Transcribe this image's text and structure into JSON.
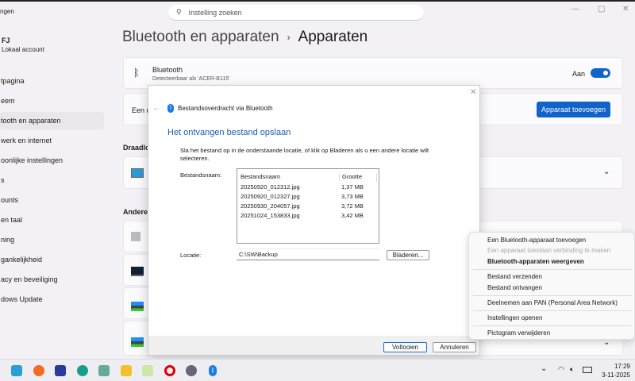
{
  "window": {
    "search_placeholder": "Instelling zoeken",
    "title_fragment": "ngen"
  },
  "user": {
    "name": "FJ",
    "account": "Lokaal account"
  },
  "sidebar": {
    "items": [
      {
        "label": "tpagina"
      },
      {
        "label": "eem"
      },
      {
        "label": "tooth en apparaten"
      },
      {
        "label": "werk en internet"
      },
      {
        "label": "oonlijke instellingen"
      },
      {
        "label": "s"
      },
      {
        "label": "ounts"
      },
      {
        "label": "en taal"
      },
      {
        "label": "ning"
      },
      {
        "label": "gankelijkheid"
      },
      {
        "label": "acy en beveiliging"
      },
      {
        "label": "dows Update"
      }
    ]
  },
  "breadcrumb": {
    "parent": "Bluetooth en apparaten",
    "sep": "›",
    "current": "Apparaten"
  },
  "bluetooth_card": {
    "title": "Bluetooth",
    "subtitle": "Detecteerbaar als 'ACER-B115'",
    "state": "Aan",
    "on": true
  },
  "add_card": {
    "text": "Een n",
    "button": "Apparaat toevoegen"
  },
  "sections": {
    "wireless": "Draadlo",
    "other": "Andere"
  },
  "dialog": {
    "header": "Bestandsoverdracht via Bluetooth",
    "title": "Het ontvangen bestand opslaan",
    "instruction": "Sla het bestand op in de onderstaande locatie, of klik op Bladeren als u een andere locatie wilt selecteren.",
    "filename_label": "Bestandsnaam:",
    "columns": [
      "Bestandsnaam",
      "Grootte"
    ],
    "files": [
      {
        "name": "20250920_012312.jpg",
        "size": "1,37 MB"
      },
      {
        "name": "20250920_012327.jpg",
        "size": "3,73 MB"
      },
      {
        "name": "20250930_204057.jpg",
        "size": "3,72 MB"
      },
      {
        "name": "20251024_153833.jpg",
        "size": "3,42 MB"
      }
    ],
    "location_label": "Locatie:",
    "location": "C:\\SW\\Backup",
    "browse": "Bladeren...",
    "finish": "Voltooien",
    "cancel": "Annuleren"
  },
  "context_menu": {
    "items": [
      {
        "label": "Een Bluetooth-apparaat toevoegen"
      },
      {
        "label": "Een apparaat toestaan verbinding te maken",
        "disabled": true
      },
      {
        "label": "Bluetooth-apparaten weergeven",
        "bold": true
      },
      {
        "label": "Bestand verzenden"
      },
      {
        "label": "Bestand ontvangen"
      },
      {
        "label": "Deelnemen aan PAN (Personal Area Network)"
      },
      {
        "label": "Instellingen openen"
      },
      {
        "label": "Pictogram verwijderen"
      }
    ]
  },
  "taskbar": {
    "time": "17:29",
    "date": "3-11-2025",
    "apps": [
      "desktop",
      "firefox",
      "save",
      "edge",
      "control-panel",
      "file-explorer",
      "photos",
      "opera",
      "settings",
      "bluetooth"
    ]
  },
  "colors": {
    "accent": "#1163c9",
    "dialog_title": "#1a5fb4"
  }
}
